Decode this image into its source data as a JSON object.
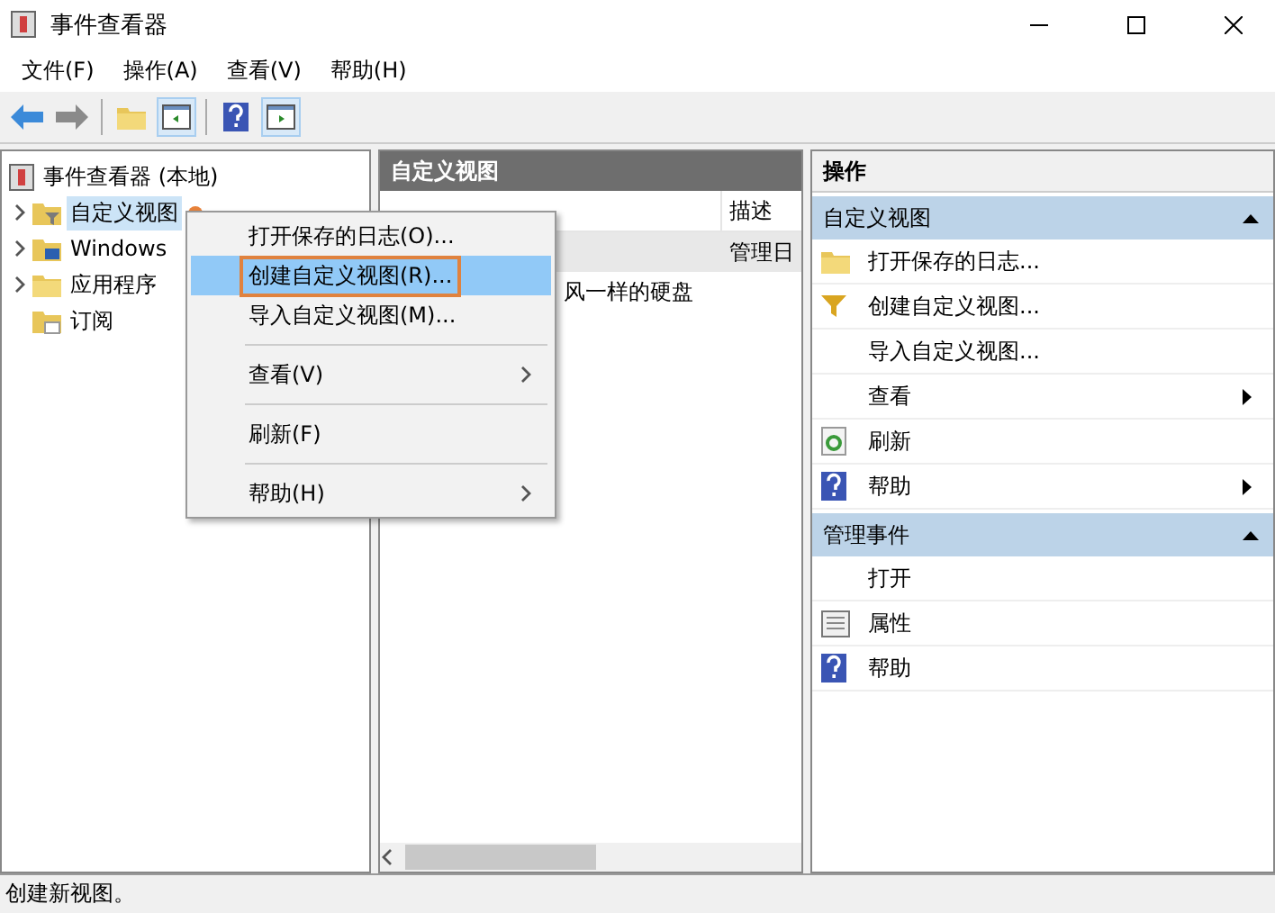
{
  "window": {
    "title": "事件查看器"
  },
  "menu_bar": [
    "文件(F)",
    "操作(A)",
    "查看(V)",
    "帮助(H)"
  ],
  "toolbar": [
    [
      {
        "kind": "back",
        "pressed": false
      },
      {
        "kind": "forward",
        "pressed": false
      }
    ],
    [
      {
        "kind": "folder-up",
        "pressed": false
      },
      {
        "kind": "pane-left",
        "pressed": true
      }
    ],
    [
      {
        "kind": "help",
        "pressed": false
      },
      {
        "kind": "pane-right",
        "pressed": true
      }
    ]
  ],
  "tree": {
    "label": "事件查看器 (本地)",
    "children": [
      {
        "label": "自定义视图",
        "expandable": true,
        "selected": true,
        "kind": "filter-folder"
      },
      {
        "label": "Windows",
        "expandable": true,
        "selected": false,
        "kind": "windows-folder"
      },
      {
        "label": "应用程序",
        "expandable": true,
        "selected": false,
        "kind": "folder"
      },
      {
        "label": "订阅",
        "expandable": false,
        "selected": false,
        "kind": "sub-folder"
      }
    ]
  },
  "center": {
    "title": "自定义视图",
    "column_2": "描述",
    "rows": [
      {
        "column_2": "管理日",
        "selected": true
      },
      {
        "column_1": "风一样的硬盘",
        "selected": false
      }
    ]
  },
  "context_menu": [
    [
      {
        "label": "打开保存的日志(O)...",
        "submenu": false,
        "selected": false,
        "outlined": false
      },
      {
        "label": "创建自定义视图(R)...",
        "submenu": false,
        "selected": true,
        "outlined": true
      },
      {
        "label": "导入自定义视图(M)...",
        "submenu": false,
        "selected": false,
        "outlined": false
      }
    ],
    [
      {
        "label": "查看(V)",
        "submenu": true,
        "selected": false,
        "outlined": false
      }
    ],
    [
      {
        "label": "刷新(F)",
        "submenu": false,
        "selected": false,
        "outlined": false
      }
    ],
    [
      {
        "label": "帮助(H)",
        "submenu": true,
        "selected": false,
        "outlined": false
      }
    ]
  ],
  "actions": {
    "title": "操作",
    "sections": [
      {
        "title": "自定义视图",
        "expanded": true,
        "items": [
          {
            "label": "打开保存的日志...",
            "kind": "folder",
            "submenu": false
          },
          {
            "label": "创建自定义视图...",
            "kind": "filter",
            "submenu": false
          },
          {
            "label": "导入自定义视图...",
            "kind": "plain",
            "submenu": false
          },
          {
            "label": "查看",
            "kind": "plain",
            "submenu": true
          },
          {
            "label": "刷新",
            "kind": "refresh",
            "submenu": false
          },
          {
            "label": "帮助",
            "kind": "help",
            "submenu": true
          }
        ]
      },
      {
        "title": "管理事件",
        "expanded": true,
        "items": [
          {
            "label": "打开",
            "kind": "plain",
            "submenu": false
          },
          {
            "label": "属性",
            "kind": "properties",
            "submenu": false
          },
          {
            "label": "帮助",
            "kind": "help",
            "submenu": false
          }
        ]
      }
    ]
  },
  "status_bar": "创建新视图。"
}
